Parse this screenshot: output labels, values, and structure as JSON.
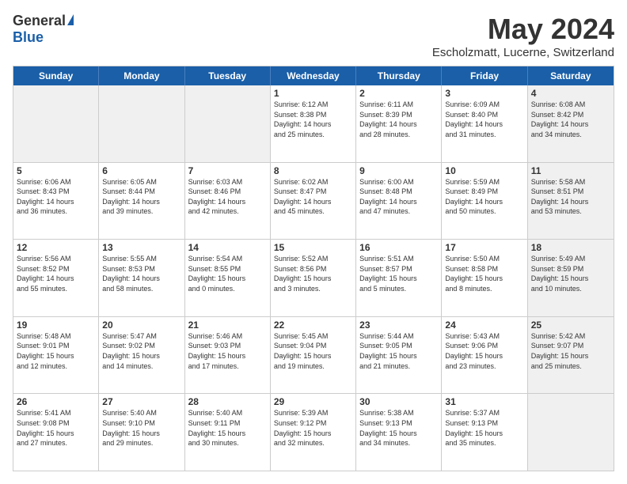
{
  "header": {
    "logo_general": "General",
    "logo_blue": "Blue",
    "month": "May 2024",
    "location": "Escholzmatt, Lucerne, Switzerland"
  },
  "days_of_week": [
    "Sunday",
    "Monday",
    "Tuesday",
    "Wednesday",
    "Thursday",
    "Friday",
    "Saturday"
  ],
  "weeks": [
    [
      {
        "day": "",
        "text": "",
        "shade": true
      },
      {
        "day": "",
        "text": "",
        "shade": true
      },
      {
        "day": "",
        "text": "",
        "shade": true
      },
      {
        "day": "1",
        "text": "Sunrise: 6:12 AM\nSunset: 8:38 PM\nDaylight: 14 hours\nand 25 minutes."
      },
      {
        "day": "2",
        "text": "Sunrise: 6:11 AM\nSunset: 8:39 PM\nDaylight: 14 hours\nand 28 minutes."
      },
      {
        "day": "3",
        "text": "Sunrise: 6:09 AM\nSunset: 8:40 PM\nDaylight: 14 hours\nand 31 minutes."
      },
      {
        "day": "4",
        "text": "Sunrise: 6:08 AM\nSunset: 8:42 PM\nDaylight: 14 hours\nand 34 minutes.",
        "shade": true
      }
    ],
    [
      {
        "day": "5",
        "text": "Sunrise: 6:06 AM\nSunset: 8:43 PM\nDaylight: 14 hours\nand 36 minutes."
      },
      {
        "day": "6",
        "text": "Sunrise: 6:05 AM\nSunset: 8:44 PM\nDaylight: 14 hours\nand 39 minutes."
      },
      {
        "day": "7",
        "text": "Sunrise: 6:03 AM\nSunset: 8:46 PM\nDaylight: 14 hours\nand 42 minutes."
      },
      {
        "day": "8",
        "text": "Sunrise: 6:02 AM\nSunset: 8:47 PM\nDaylight: 14 hours\nand 45 minutes."
      },
      {
        "day": "9",
        "text": "Sunrise: 6:00 AM\nSunset: 8:48 PM\nDaylight: 14 hours\nand 47 minutes."
      },
      {
        "day": "10",
        "text": "Sunrise: 5:59 AM\nSunset: 8:49 PM\nDaylight: 14 hours\nand 50 minutes."
      },
      {
        "day": "11",
        "text": "Sunrise: 5:58 AM\nSunset: 8:51 PM\nDaylight: 14 hours\nand 53 minutes.",
        "shade": true
      }
    ],
    [
      {
        "day": "12",
        "text": "Sunrise: 5:56 AM\nSunset: 8:52 PM\nDaylight: 14 hours\nand 55 minutes."
      },
      {
        "day": "13",
        "text": "Sunrise: 5:55 AM\nSunset: 8:53 PM\nDaylight: 14 hours\nand 58 minutes."
      },
      {
        "day": "14",
        "text": "Sunrise: 5:54 AM\nSunset: 8:55 PM\nDaylight: 15 hours\nand 0 minutes."
      },
      {
        "day": "15",
        "text": "Sunrise: 5:52 AM\nSunset: 8:56 PM\nDaylight: 15 hours\nand 3 minutes."
      },
      {
        "day": "16",
        "text": "Sunrise: 5:51 AM\nSunset: 8:57 PM\nDaylight: 15 hours\nand 5 minutes."
      },
      {
        "day": "17",
        "text": "Sunrise: 5:50 AM\nSunset: 8:58 PM\nDaylight: 15 hours\nand 8 minutes."
      },
      {
        "day": "18",
        "text": "Sunrise: 5:49 AM\nSunset: 8:59 PM\nDaylight: 15 hours\nand 10 minutes.",
        "shade": true
      }
    ],
    [
      {
        "day": "19",
        "text": "Sunrise: 5:48 AM\nSunset: 9:01 PM\nDaylight: 15 hours\nand 12 minutes."
      },
      {
        "day": "20",
        "text": "Sunrise: 5:47 AM\nSunset: 9:02 PM\nDaylight: 15 hours\nand 14 minutes."
      },
      {
        "day": "21",
        "text": "Sunrise: 5:46 AM\nSunset: 9:03 PM\nDaylight: 15 hours\nand 17 minutes."
      },
      {
        "day": "22",
        "text": "Sunrise: 5:45 AM\nSunset: 9:04 PM\nDaylight: 15 hours\nand 19 minutes."
      },
      {
        "day": "23",
        "text": "Sunrise: 5:44 AM\nSunset: 9:05 PM\nDaylight: 15 hours\nand 21 minutes."
      },
      {
        "day": "24",
        "text": "Sunrise: 5:43 AM\nSunset: 9:06 PM\nDaylight: 15 hours\nand 23 minutes."
      },
      {
        "day": "25",
        "text": "Sunrise: 5:42 AM\nSunset: 9:07 PM\nDaylight: 15 hours\nand 25 minutes.",
        "shade": true
      }
    ],
    [
      {
        "day": "26",
        "text": "Sunrise: 5:41 AM\nSunset: 9:08 PM\nDaylight: 15 hours\nand 27 minutes."
      },
      {
        "day": "27",
        "text": "Sunrise: 5:40 AM\nSunset: 9:10 PM\nDaylight: 15 hours\nand 29 minutes."
      },
      {
        "day": "28",
        "text": "Sunrise: 5:40 AM\nSunset: 9:11 PM\nDaylight: 15 hours\nand 30 minutes."
      },
      {
        "day": "29",
        "text": "Sunrise: 5:39 AM\nSunset: 9:12 PM\nDaylight: 15 hours\nand 32 minutes."
      },
      {
        "day": "30",
        "text": "Sunrise: 5:38 AM\nSunset: 9:13 PM\nDaylight: 15 hours\nand 34 minutes."
      },
      {
        "day": "31",
        "text": "Sunrise: 5:37 AM\nSunset: 9:13 PM\nDaylight: 15 hours\nand 35 minutes."
      },
      {
        "day": "",
        "text": "",
        "shade": true
      }
    ]
  ]
}
